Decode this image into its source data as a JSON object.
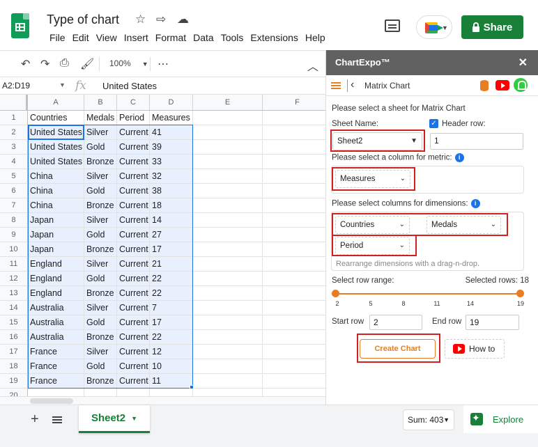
{
  "header": {
    "doc_title": "Type of chart",
    "menu": [
      "File",
      "Edit",
      "View",
      "Insert",
      "Format",
      "Data",
      "Tools",
      "Extensions",
      "Help"
    ],
    "share_label": "Share"
  },
  "toolbar": {
    "zoom": "100%"
  },
  "formula_bar": {
    "name_box": "A2:D19",
    "value": "United States"
  },
  "grid": {
    "columns": [
      "A",
      "B",
      "C",
      "D",
      "E",
      "F"
    ],
    "rows": [
      {
        "n": "1",
        "cells": [
          "Countries",
          "Medals",
          "Period",
          "Measures"
        ]
      },
      {
        "n": "2",
        "cells": [
          "United States",
          "Silver",
          "Current",
          "41"
        ]
      },
      {
        "n": "3",
        "cells": [
          "United States",
          "Gold",
          "Current",
          "39"
        ]
      },
      {
        "n": "4",
        "cells": [
          "United States",
          "Bronze",
          "Current",
          "33"
        ]
      },
      {
        "n": "5",
        "cells": [
          "China",
          "Silver",
          "Current",
          "32"
        ]
      },
      {
        "n": "6",
        "cells": [
          "China",
          "Gold",
          "Current",
          "38"
        ]
      },
      {
        "n": "7",
        "cells": [
          "China",
          "Bronze",
          "Current",
          "18"
        ]
      },
      {
        "n": "8",
        "cells": [
          "Japan",
          "Silver",
          "Current",
          "14"
        ]
      },
      {
        "n": "9",
        "cells": [
          "Japan",
          "Gold",
          "Current",
          "27"
        ]
      },
      {
        "n": "10",
        "cells": [
          "Japan",
          "Bronze",
          "Current",
          "17"
        ]
      },
      {
        "n": "11",
        "cells": [
          "England",
          "Silver",
          "Current",
          "21"
        ]
      },
      {
        "n": "12",
        "cells": [
          "England",
          "Gold",
          "Current",
          "22"
        ]
      },
      {
        "n": "13",
        "cells": [
          "England",
          "Bronze",
          "Current",
          "22"
        ]
      },
      {
        "n": "14",
        "cells": [
          "Australia",
          "Silver",
          "Current",
          "7"
        ]
      },
      {
        "n": "15",
        "cells": [
          "Australia",
          "Gold",
          "Current",
          "17"
        ]
      },
      {
        "n": "16",
        "cells": [
          "Australia",
          "Bronze",
          "Current",
          "22"
        ]
      },
      {
        "n": "17",
        "cells": [
          "France",
          "Silver",
          "Current",
          "12"
        ]
      },
      {
        "n": "18",
        "cells": [
          "France",
          "Gold",
          "Current",
          "10"
        ]
      },
      {
        "n": "19",
        "cells": [
          "France",
          "Bronze",
          "Current",
          "11"
        ]
      },
      {
        "n": "20",
        "cells": [
          "",
          "",
          "",
          ""
        ]
      }
    ]
  },
  "sheetbar": {
    "sheet_name": "Sheet2",
    "sum": "Sum: 403",
    "explore": "Explore"
  },
  "panel": {
    "title": "ChartExpo™",
    "nav_title": "Matrix Chart",
    "select_sheet_prompt": "Please select a sheet for Matrix Chart",
    "sheet_name_label": "Sheet Name:",
    "sheet_value": "Sheet2",
    "header_row_label": "Header row:",
    "header_row_value": "1",
    "metric_prompt": "Please select a column for metric:",
    "metric_value": "Measures",
    "dimensions_prompt": "Please select columns for dimensions:",
    "dim1": "Countries",
    "dim2": "Medals",
    "dim3": "Period",
    "dim_hint": "Rearrange dimensions with a drag-n-drop.",
    "row_range_label": "Select row range:",
    "selected_rows": "Selected rows: 18",
    "ticks": [
      "2",
      "5",
      "8",
      "11",
      "14",
      "19"
    ],
    "start_row_label": "Start row",
    "start_row": "2",
    "end_row_label": "End row",
    "end_row": "19",
    "create_chart": "Create Chart",
    "how_to": "How to"
  }
}
